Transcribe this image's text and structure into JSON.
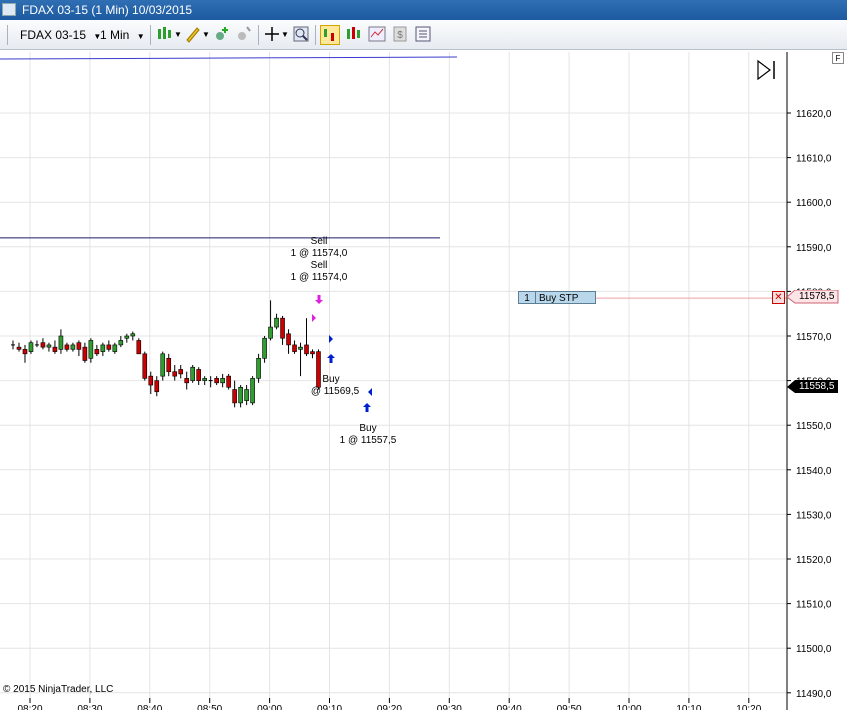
{
  "window": {
    "title": "FDAX 03-15 (1 Min)  10/03/2015"
  },
  "toolbar": {
    "instrument": "FDAX 03-15",
    "interval": "1 Min",
    "icons": [
      "chart-style-icon",
      "drawing-tools-icon",
      "add-indicator-icon",
      "add-strategy-icon",
      "crosshair-icon",
      "zoom-icon",
      "chart-trader-icon",
      "bar-style-icon",
      "performance-icon",
      "price-marker-icon",
      "properties-icon"
    ]
  },
  "chart": {
    "copyright": "© 2015 NinjaTrader, LLC",
    "f_button": "F",
    "price_axis": [
      "11620,0",
      "11610,0",
      "11600,0",
      "11590,0",
      "11580,0",
      "11570,0",
      "11560,0",
      "11550,0",
      "11540,0",
      "11530,0",
      "11520,0",
      "11510,0",
      "11500,0",
      "11490,0"
    ],
    "time_axis": [
      "08:20",
      "08:30",
      "08:40",
      "08:50",
      "09:00",
      "09:10",
      "09:20",
      "09:30",
      "09:40",
      "09:50",
      "10:00",
      "10:10",
      "10:20"
    ],
    "last_price": "11558,5",
    "order_price": "11578,5",
    "order": {
      "qty": "1",
      "type": "Buy STP"
    },
    "executions": [
      {
        "side": "Sell",
        "line2": "1 @ 11574,0"
      },
      {
        "side": "Sell",
        "line2": "1 @ 11574,0"
      },
      {
        "side": "Buy",
        "line2": "@ 11569,5"
      },
      {
        "side": "Buy",
        "line2": "1 @ 11557,5"
      }
    ],
    "colors": {
      "up": "#2e9e2e",
      "down": "#cc0000",
      "order_line": "#f0a0a8",
      "sell_arrow": "#e020e0",
      "buy_arrow": "#0020d0",
      "level_line": "#1b1b6b"
    }
  },
  "chart_data": {
    "type": "candlestick",
    "title": "FDAX 03-15 (1 Min)",
    "ylim": [
      11489,
      11625
    ],
    "x_ticks": [
      "08:20",
      "08:30",
      "08:40",
      "08:50",
      "09:00",
      "09:10",
      "09:20",
      "09:30",
      "09:40",
      "09:50",
      "10:00",
      "10:10",
      "10:20"
    ],
    "candles": [
      {
        "o": 11568.0,
        "h": 11569.0,
        "l": 11567.0,
        "c": 11568.0
      },
      {
        "o": 11567.5,
        "h": 11568.5,
        "l": 11566.5,
        "c": 11567.0
      },
      {
        "o": 11567.0,
        "h": 11568.0,
        "l": 11564.0,
        "c": 11566.0
      },
      {
        "o": 11566.5,
        "h": 11569.0,
        "l": 11566.0,
        "c": 11568.5
      },
      {
        "o": 11568.0,
        "h": 11569.0,
        "l": 11567.5,
        "c": 11568.0
      },
      {
        "o": 11568.5,
        "h": 11569.5,
        "l": 11567.0,
        "c": 11567.5
      },
      {
        "o": 11567.5,
        "h": 11568.5,
        "l": 11566.5,
        "c": 11568.0
      },
      {
        "o": 11567.5,
        "h": 11569.0,
        "l": 11566.0,
        "c": 11566.5
      },
      {
        "o": 11567.0,
        "h": 11571.5,
        "l": 11566.0,
        "c": 11570.0
      },
      {
        "o": 11568.0,
        "h": 11568.5,
        "l": 11566.5,
        "c": 11567.0
      },
      {
        "o": 11567.0,
        "h": 11568.5,
        "l": 11566.5,
        "c": 11568.0
      },
      {
        "o": 11568.5,
        "h": 11569.0,
        "l": 11565.5,
        "c": 11567.0
      },
      {
        "o": 11567.5,
        "h": 11568.5,
        "l": 11564.0,
        "c": 11564.5
      },
      {
        "o": 11565.0,
        "h": 11569.5,
        "l": 11564.0,
        "c": 11569.0
      },
      {
        "o": 11567.0,
        "h": 11568.0,
        "l": 11565.5,
        "c": 11566.0
      },
      {
        "o": 11566.5,
        "h": 11568.5,
        "l": 11565.5,
        "c": 11568.0
      },
      {
        "o": 11568.0,
        "h": 11569.0,
        "l": 11566.5,
        "c": 11567.0
      },
      {
        "o": 11566.5,
        "h": 11568.5,
        "l": 11566.0,
        "c": 11568.0
      },
      {
        "o": 11568.0,
        "h": 11570.0,
        "l": 11567.5,
        "c": 11569.0
      },
      {
        "o": 11569.5,
        "h": 11570.5,
        "l": 11568.5,
        "c": 11570.0
      },
      {
        "o": 11570.0,
        "h": 11571.0,
        "l": 11569.0,
        "c": 11570.5
      },
      {
        "o": 11569.0,
        "h": 11569.5,
        "l": 11566.0,
        "c": 11566.0
      },
      {
        "o": 11566.0,
        "h": 11566.5,
        "l": 11560.0,
        "c": 11560.5
      },
      {
        "o": 11561.0,
        "h": 11562.0,
        "l": 11557.0,
        "c": 11559.0
      },
      {
        "o": 11560.0,
        "h": 11561.0,
        "l": 11556.5,
        "c": 11557.5
      },
      {
        "o": 11561.0,
        "h": 11566.5,
        "l": 11560.0,
        "c": 11566.0
      },
      {
        "o": 11565.0,
        "h": 11566.0,
        "l": 11561.0,
        "c": 11562.0
      },
      {
        "o": 11562.0,
        "h": 11563.5,
        "l": 11560.0,
        "c": 11561.0
      },
      {
        "o": 11562.5,
        "h": 11563.5,
        "l": 11560.5,
        "c": 11561.5
      },
      {
        "o": 11560.5,
        "h": 11562.0,
        "l": 11558.0,
        "c": 11559.5
      },
      {
        "o": 11560.0,
        "h": 11563.5,
        "l": 11559.5,
        "c": 11563.0
      },
      {
        "o": 11562.5,
        "h": 11563.0,
        "l": 11559.0,
        "c": 11560.0
      },
      {
        "o": 11560.0,
        "h": 11561.0,
        "l": 11559.0,
        "c": 11560.5
      },
      {
        "o": 11560.0,
        "h": 11561.0,
        "l": 11558.5,
        "c": 11560.0
      },
      {
        "o": 11560.5,
        "h": 11561.0,
        "l": 11559.0,
        "c": 11559.5
      },
      {
        "o": 11559.5,
        "h": 11561.5,
        "l": 11558.5,
        "c": 11560.5
      },
      {
        "o": 11561.0,
        "h": 11561.5,
        "l": 11558.0,
        "c": 11558.5
      },
      {
        "o": 11558.0,
        "h": 11560.0,
        "l": 11554.0,
        "c": 11555.0
      },
      {
        "o": 11555.0,
        "h": 11559.0,
        "l": 11554.0,
        "c": 11558.5
      },
      {
        "o": 11555.5,
        "h": 11559.0,
        "l": 11554.5,
        "c": 11558.0
      },
      {
        "o": 11555.0,
        "h": 11561.0,
        "l": 11554.5,
        "c": 11560.5
      },
      {
        "o": 11560.5,
        "h": 11566.0,
        "l": 11559.5,
        "c": 11565.0
      },
      {
        "o": 11565.0,
        "h": 11570.0,
        "l": 11564.0,
        "c": 11569.5
      },
      {
        "o": 11569.5,
        "h": 11578.0,
        "l": 11569.0,
        "c": 11572.0
      },
      {
        "o": 11572.0,
        "h": 11575.0,
        "l": 11571.5,
        "c": 11574.0
      },
      {
        "o": 11574.0,
        "h": 11574.5,
        "l": 11568.0,
        "c": 11569.5
      },
      {
        "o": 11570.5,
        "h": 11571.5,
        "l": 11566.0,
        "c": 11568.0
      },
      {
        "o": 11568.0,
        "h": 11569.0,
        "l": 11566.0,
        "c": 11566.5
      },
      {
        "o": 11567.0,
        "h": 11568.5,
        "l": 11561.0,
        "c": 11567.5
      },
      {
        "o": 11568.0,
        "h": 11574.0,
        "l": 11565.5,
        "c": 11566.0
      },
      {
        "o": 11566.5,
        "h": 11567.0,
        "l": 11565.0,
        "c": 11566.0
      },
      {
        "o": 11566.5,
        "h": 11567.0,
        "l": 11558.0,
        "c": 11558.5
      }
    ],
    "levels": [
      11592.0,
      11578.5
    ],
    "last_price": 11558.5
  }
}
